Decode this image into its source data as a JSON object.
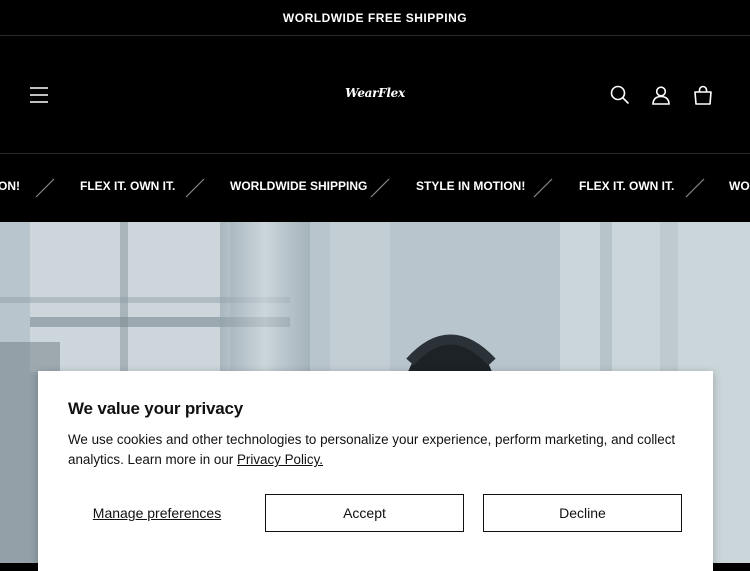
{
  "announcement": {
    "text": "WORLDWIDE FREE SHIPPING"
  },
  "header": {
    "logo": "WearFlex",
    "menu_icon": "hamburger-icon",
    "search_icon": "search-icon",
    "account_icon": "account-icon",
    "cart_icon": "cart-icon"
  },
  "marquee": {
    "items": [
      "ON!",
      "FLEX IT. OWN IT.",
      "WORLDWIDE SHIPPING",
      "STYLE IN MOTION!",
      "FLEX IT. OWN IT.",
      "WOR"
    ]
  },
  "consent": {
    "title": "We value your privacy",
    "body": "We use cookies and other technologies to personalize your experience, perform marketing, and collect analytics. Learn more in our ",
    "link": "Privacy Policy.",
    "manage_label": "Manage preferences",
    "accept_label": "Accept",
    "decline_label": "Decline"
  }
}
